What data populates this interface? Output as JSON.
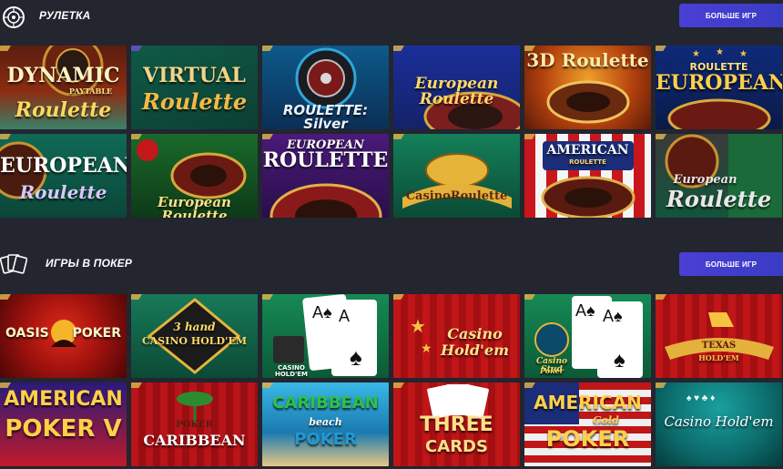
{
  "sections": [
    {
      "title": "РУЛЕТКА",
      "more_label": "БОЛЬШЕ ИГР",
      "icon": "roulette-wheel-icon",
      "games": [
        {
          "l1": "DYNAMIC",
          "l2": "Roulette",
          "small": "PAYTABLE"
        },
        {
          "l1": "VIRTUAL",
          "l2": "Roulette"
        },
        {
          "l1": "ROULETTE: Silver"
        },
        {
          "l1": "European Roulette"
        },
        {
          "l1": "3D Roulette"
        },
        {
          "l1": "ROULETTE",
          "l2": "EUROPEAN"
        },
        {
          "l1": "EUROPEAN",
          "l2": "Roulette"
        },
        {
          "l1": "European Roulette"
        },
        {
          "l1": "EUROPEAN",
          "l2": "ROULETTE"
        },
        {
          "l1": "CasinoRoulette"
        },
        {
          "l1": "AMERICAN",
          "l2": "ROULETTE"
        },
        {
          "l1": "European",
          "l2": "Roulette"
        }
      ]
    },
    {
      "title": "ИГРЫ В ПОКЕР",
      "more_label": "БОЛЬШЕ ИГР",
      "icon": "playing-cards-icon",
      "games": [
        {
          "l1": "OASIS",
          "l2": "POKER"
        },
        {
          "l1": "3 hand",
          "l2": "CASINO HOLD'EM"
        },
        {
          "l1": "CASINO HOLD'EM"
        },
        {
          "l1": "Casino",
          "l2": "Hold'em"
        },
        {
          "l1": "Casino Stud",
          "l2": "Poker"
        },
        {
          "l1": "TEXAS",
          "l2": "HOLD'EM"
        },
        {
          "l1": "AMERICAN",
          "l2": "POKER V"
        },
        {
          "l1": "POKER",
          "l2": "CARIBBEAN"
        },
        {
          "l1": "CARIBBEAN",
          "l2": "POKER",
          "small": "beach"
        },
        {
          "l1": "THREE",
          "l2": "CARDS"
        },
        {
          "l1": "AMERICAN",
          "l2": "POKER",
          "small": "Gold"
        },
        {
          "l1": "Casino Hold'em"
        }
      ]
    }
  ],
  "colors": {
    "background": "#23252f",
    "button": "#4a3fd6",
    "tile_notch": "#d9b04a"
  }
}
